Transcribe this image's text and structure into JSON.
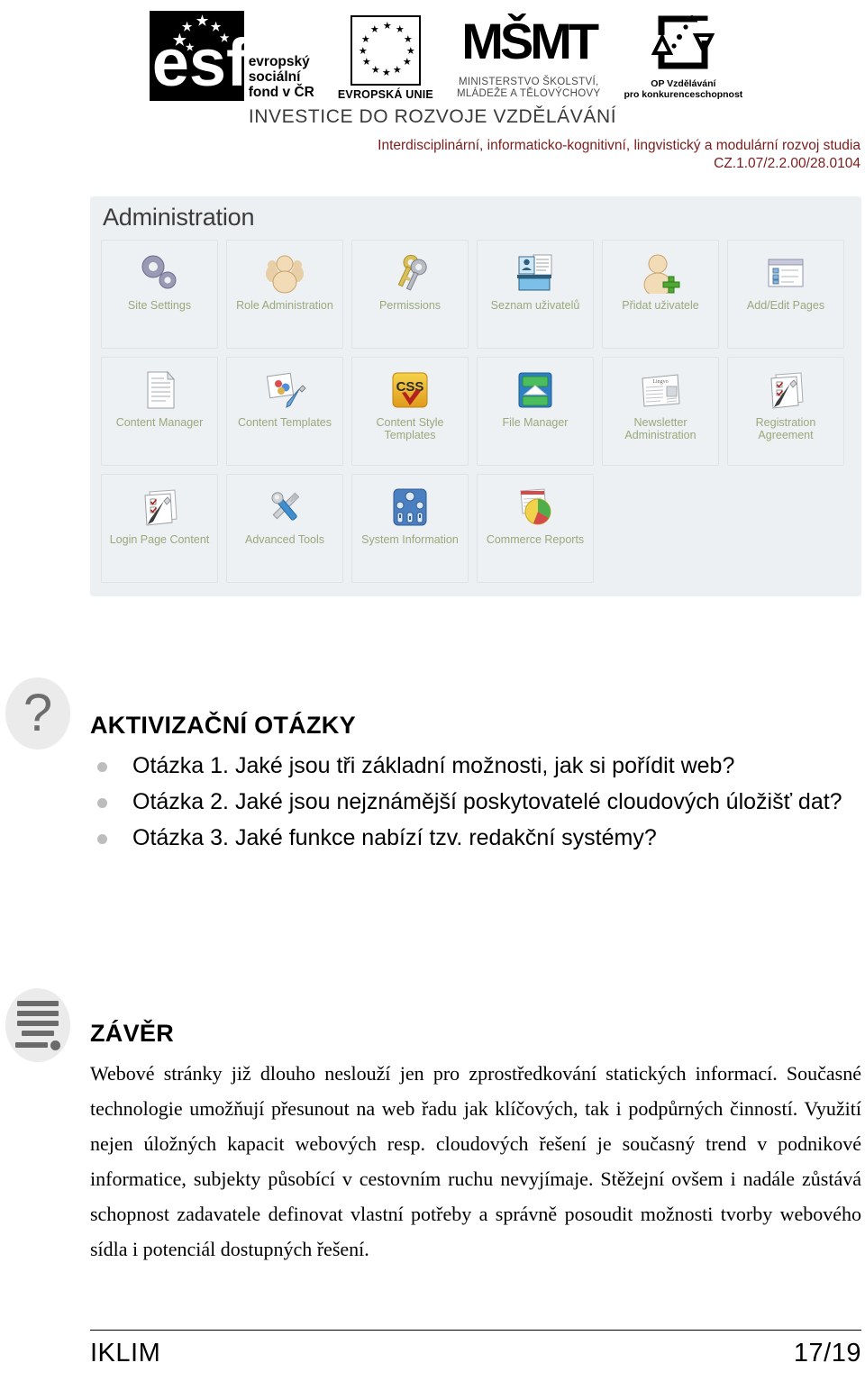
{
  "header": {
    "esf": {
      "letters": "esf",
      "text_lines": [
        "evropský",
        "sociální",
        "fond v ČR"
      ]
    },
    "eu": {
      "caption": "EVROPSKÁ UNIE"
    },
    "msmt": {
      "mark": "MŠMT",
      "caption_lines": [
        "MINISTERSTVO ŠKOLSTVÍ,",
        "MLÁDEŽE A TĚLOVÝCHOVY"
      ]
    },
    "op": {
      "caption_lines": [
        "OP Vzdělávání",
        "pro konkurenceschopnost"
      ]
    },
    "investice": "INVESTICE DO ROZVOJE VZDĚLÁVÁNÍ",
    "project_title": "Interdisciplinární, informaticko-kognitivní, lingvistický a modulární rozvoj studia",
    "project_code": "CZ.1.07/2.2.00/28.0104",
    "project_color": "#7a1c1c"
  },
  "admin_panel": {
    "title": "Administration",
    "label_color": "#9aa87c",
    "tiles": [
      [
        {
          "label": "Site Settings",
          "icon": "gears-icon"
        },
        {
          "label": "Role Administration",
          "icon": "users-group-icon"
        },
        {
          "label": "Permissions",
          "icon": "keys-icon"
        },
        {
          "label": "Seznam uživatelů",
          "icon": "user-list-icon"
        },
        {
          "label": "Přidat uživatele",
          "icon": "add-user-icon"
        },
        {
          "label": "Add/Edit Pages",
          "icon": "window-list-icon"
        }
      ],
      [
        {
          "label": "Content Manager",
          "icon": "document-icon"
        },
        {
          "label": "Content Templates",
          "icon": "template-pencil-icon"
        },
        {
          "label": "Content Style Templates",
          "icon": "css-icon"
        },
        {
          "label": "File Manager",
          "icon": "file-drawer-icon"
        },
        {
          "label": "Newsletter Administration",
          "icon": "newspaper-icon"
        },
        {
          "label": "Registration Agreement",
          "icon": "checklist-pen-icon"
        }
      ],
      [
        {
          "label": "Login Page Content",
          "icon": "checklist-pen-icon"
        },
        {
          "label": "Advanced Tools",
          "icon": "tools-icon"
        },
        {
          "label": "System Information",
          "icon": "gauges-panel-icon"
        },
        {
          "label": "Commerce Reports",
          "icon": "pie-chart-report-icon"
        }
      ]
    ],
    "css_badge_text": "CSS"
  },
  "questions": {
    "badge_icon": "question-mark-icon",
    "badge_glyph": "?",
    "heading": "AKTIVIZAČNÍ OTÁZKY",
    "items": [
      "Otázka 1. Jaké jsou tři základní možnosti, jak si pořídit web?",
      "Otázka 2. Jaké jsou nejznámější poskytovatelé cloudových úložišť dat?",
      "Otázka 3. Jaké funkce nabízí tzv. redakční systémy?"
    ]
  },
  "conclusion": {
    "badge_icon": "list-lines-icon",
    "heading": "ZÁVĚR",
    "body": "Webové stránky již dlouho neslouží jen pro zprostředkování statických informací. Současné technologie umožňují přesunout na web řadu jak klíčových, tak i podpůrných činností. Využití nejen úložných kapacit webových resp. cloudových řešení je současný trend v podnikové informatice, subjekty působící v cestovním ruchu nevyjímaje. Stěžejní ovšem i nadále zůstává schopnost zadavatele definovat vlastní potřeby a správně posoudit možnosti tvorby webového sídla i potenciál dostupných řešení."
  },
  "footer": {
    "left": "IKLIM",
    "right": "17/19"
  }
}
